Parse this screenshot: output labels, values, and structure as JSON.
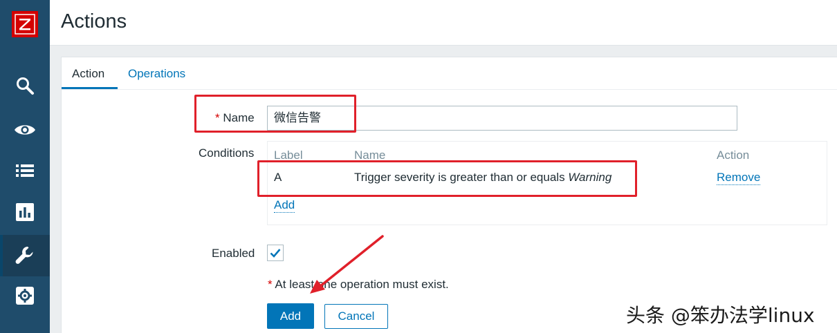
{
  "logo": {
    "letter": "Z"
  },
  "sidebar": {
    "items": [
      {
        "name": "search",
        "icon": "search-icon"
      },
      {
        "name": "monitoring",
        "icon": "eye-icon"
      },
      {
        "name": "inventory",
        "icon": "list-icon"
      },
      {
        "name": "reports",
        "icon": "bar-chart-icon"
      },
      {
        "name": "configuration",
        "icon": "wrench-icon",
        "active": true
      },
      {
        "name": "administration",
        "icon": "gear-icon"
      }
    ]
  },
  "header": {
    "title": "Actions"
  },
  "tabs": [
    {
      "label": "Action",
      "active": true
    },
    {
      "label": "Operations",
      "active": false
    }
  ],
  "form": {
    "name_required_mark": "*",
    "name_label": "Name",
    "name_value": "微信告警",
    "conditions_label": "Conditions",
    "conditions": {
      "headers": {
        "label": "Label",
        "name": "Name",
        "action": "Action"
      },
      "rows": [
        {
          "label": "A",
          "name_prefix": "Trigger severity is greater than or equals",
          "name_value": "Warning",
          "action": "Remove"
        }
      ],
      "add_link": "Add"
    },
    "enabled_label": "Enabled",
    "enabled_checked": true,
    "warning_mark": "*",
    "warning_text": "At least one operation must exist.",
    "add_button": "Add",
    "cancel_button": "Cancel"
  },
  "watermark": "头条 @笨办法学linux",
  "colors": {
    "accent": "#0275b8",
    "sidebar": "#1f4c6b",
    "annotation": "#e0202a",
    "required": "#d40000"
  }
}
